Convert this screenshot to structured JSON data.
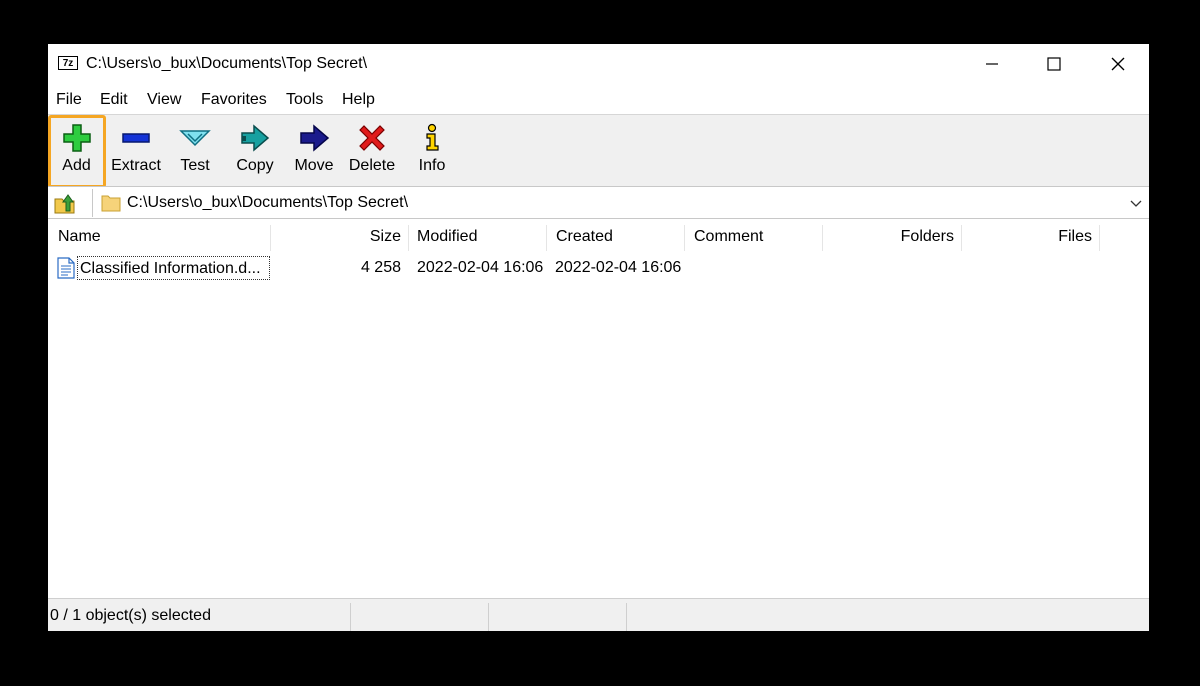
{
  "window": {
    "app_icon_text": "7z",
    "title": "C:\\Users\\o_bux\\Documents\\Top Secret\\"
  },
  "menu": [
    "File",
    "Edit",
    "View",
    "Favorites",
    "Tools",
    "Help"
  ],
  "toolbar": {
    "add": "Add",
    "extract": "Extract",
    "test": "Test",
    "copy": "Copy",
    "move": "Move",
    "delete": "Delete",
    "info": "Info"
  },
  "address": {
    "path": "C:\\Users\\o_bux\\Documents\\Top Secret\\"
  },
  "columns": {
    "name": "Name",
    "size": "Size",
    "modified": "Modified",
    "created": "Created",
    "comment": "Comment",
    "folders": "Folders",
    "files": "Files"
  },
  "rows": [
    {
      "name": "Classified Information.d...",
      "size": "4 258",
      "modified": "2022-02-04 16:06",
      "created": "2022-02-04 16:06",
      "comment": "",
      "folders": "",
      "files": ""
    }
  ],
  "status": {
    "selection": "0 / 1 object(s) selected"
  },
  "colors": {
    "highlight": "#f5a623",
    "toolbar_bg": "#f0f0f0"
  }
}
